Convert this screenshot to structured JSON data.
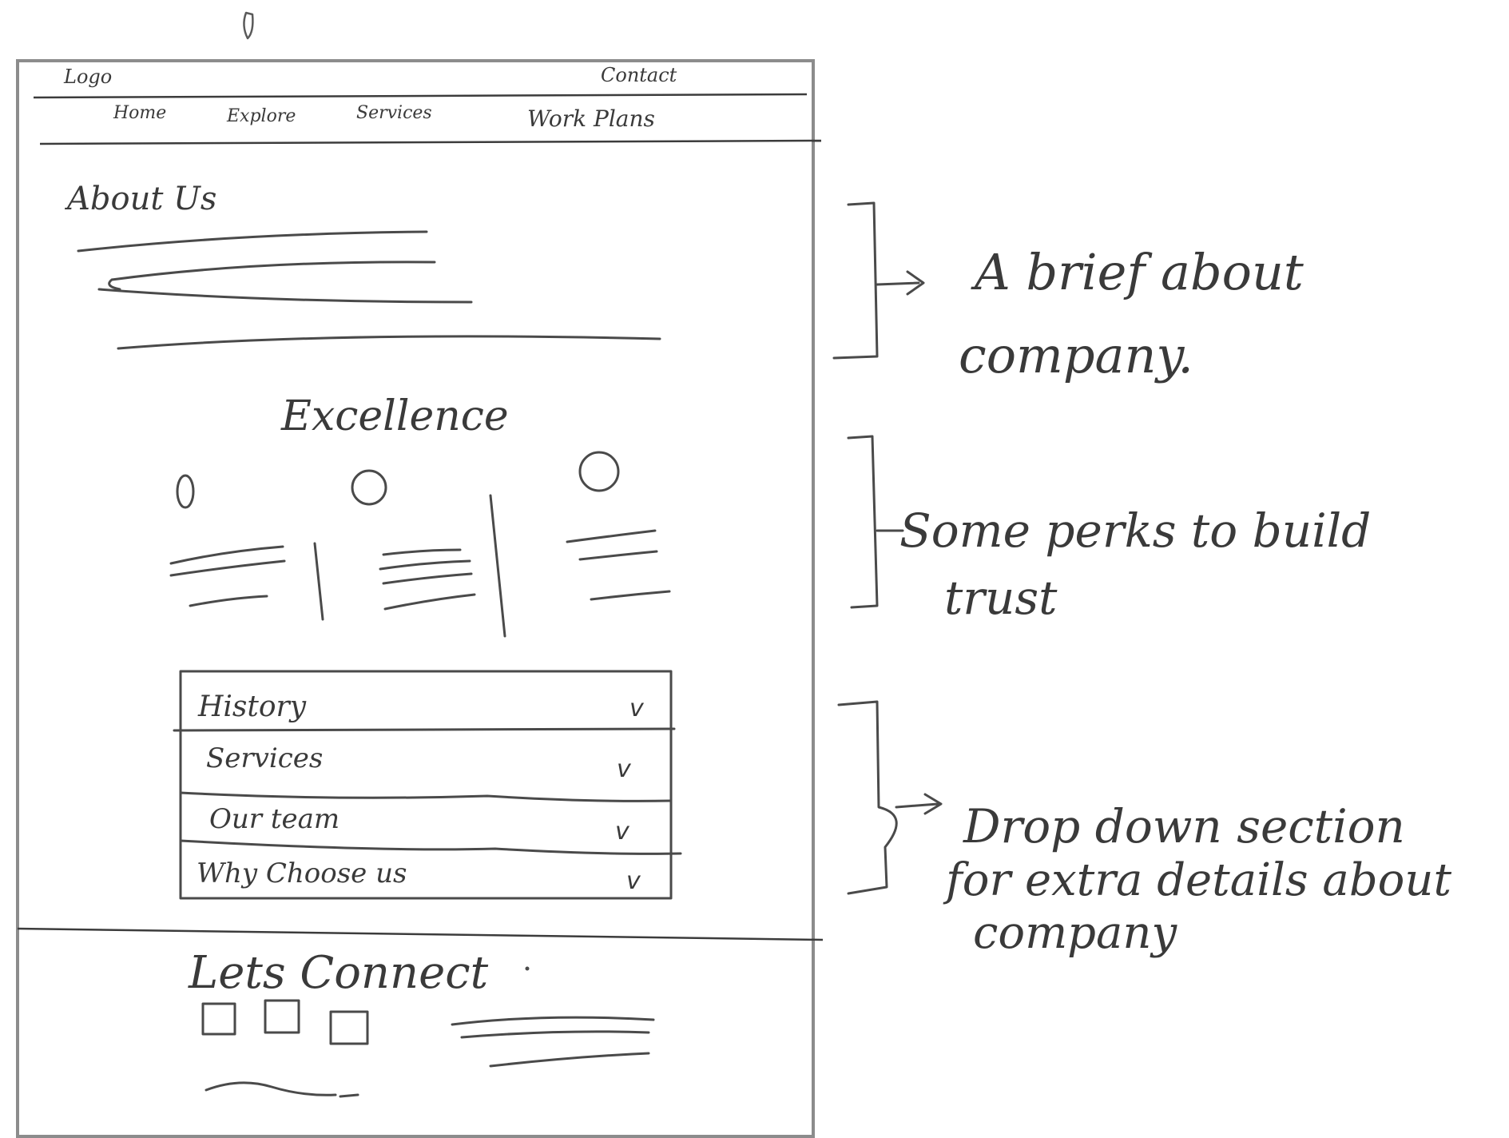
{
  "header": {
    "logo": "Logo",
    "contact": "Contact",
    "nav": [
      "Home",
      "Explore",
      "Services",
      "Work Plans"
    ]
  },
  "about": {
    "heading": "About Us"
  },
  "excellence": {
    "heading": "Excellence",
    "column_count": 3
  },
  "accordion": {
    "items": [
      {
        "label": "History",
        "chevron": "v"
      },
      {
        "label": "Services",
        "chevron": "v"
      },
      {
        "label": "Our team",
        "chevron": "v"
      },
      {
        "label": "Why Choose us",
        "chevron": "v"
      }
    ]
  },
  "footer": {
    "heading": "Lets Connect",
    "social_icon_count": 3
  },
  "annotations": [
    {
      "text_line1": "A brief about",
      "text_line2": "company."
    },
    {
      "text_line1": "Some perks to build",
      "text_line2": "trust"
    },
    {
      "text_line1": "Drop down section",
      "text_line2": "for extra details about",
      "text_line3": "company"
    }
  ],
  "colors": {
    "ink": "#3a3a3a",
    "frame": "#8c8c8c",
    "paper": "#ffffff"
  }
}
